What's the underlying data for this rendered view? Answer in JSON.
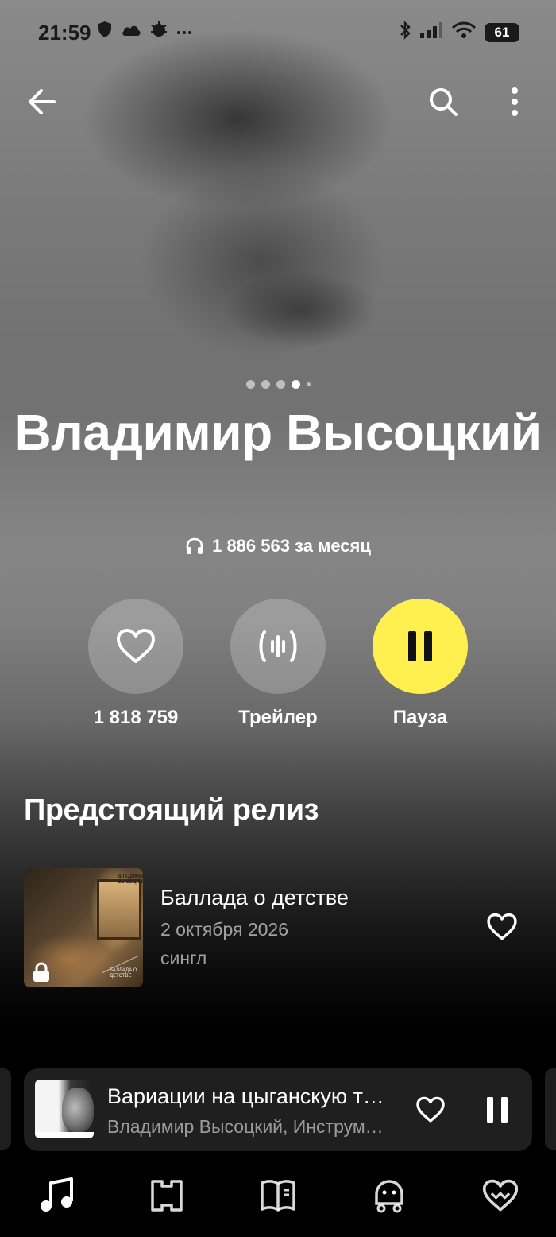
{
  "status_bar": {
    "time": "21:59",
    "battery": "61",
    "icons_left": [
      "vpn-shield-icon",
      "cloud-icon",
      "gear-bug-icon",
      "more-dots-icon"
    ],
    "icons_right": [
      "bluetooth-icon",
      "signal-icon",
      "wifi-icon",
      "battery-icon"
    ]
  },
  "artist": {
    "name": "Владимир Высоцкий",
    "listeners": "1 886 563 за месяц",
    "carousel_pages": 5,
    "carousel_active_index": 3
  },
  "actions": {
    "like_count": "1 818 759",
    "trailer_label": "Трейлер",
    "pause_label": "Пауза"
  },
  "upcoming": {
    "section_title": "Предстоящий релиз",
    "release_title": "Баллада о детстве",
    "release_date": "2 октября 2026",
    "release_type": "сингл",
    "cover_text_top": "ВЛАДИМИР ВЫСОЦКИЙ",
    "cover_text_bottom": "БАЛЛАДА О ДЕТСТВЕ"
  },
  "now_playing": {
    "title": "Вариации на цыганскую тему",
    "artist": "Владимир Высоцкий, Инструментальный ансамбль"
  },
  "bottom_nav": [
    "music-note-icon",
    "map-icon",
    "book-icon",
    "kids-icon",
    "heart-wave-icon"
  ],
  "colors": {
    "accent_yellow": "#fff04f",
    "background": "#000000",
    "mini_player_bg": "#1f1f1f"
  }
}
